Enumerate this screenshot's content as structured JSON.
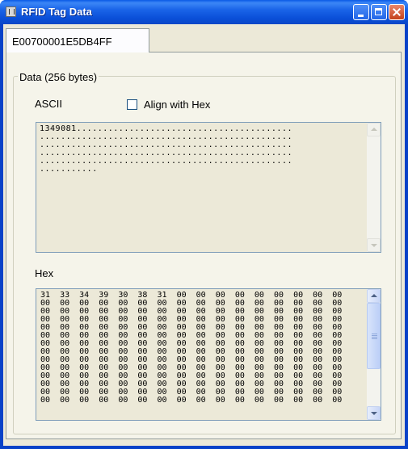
{
  "window": {
    "title": "RFID Tag Data"
  },
  "tabs": [
    {
      "label": "E00700001E5DB4FF",
      "selected": true
    }
  ],
  "data_group": {
    "label": "Data (256 bytes)"
  },
  "ascii": {
    "label": "ASCII",
    "align_with_hex_label": "Align with Hex",
    "align_with_hex_checked": false,
    "text": "1349081.........................................\n................................................\n................................................\n................................................\n................................................\n..........."
  },
  "hex": {
    "label": "Hex",
    "text": "31  33  34  39  30  38  31  00  00  00  00  00  00  00  00  00\n00  00  00  00  00  00  00  00  00  00  00  00  00  00  00  00\n00  00  00  00  00  00  00  00  00  00  00  00  00  00  00  00\n00  00  00  00  00  00  00  00  00  00  00  00  00  00  00  00\n00  00  00  00  00  00  00  00  00  00  00  00  00  00  00  00\n00  00  00  00  00  00  00  00  00  00  00  00  00  00  00  00\n00  00  00  00  00  00  00  00  00  00  00  00  00  00  00  00\n00  00  00  00  00  00  00  00  00  00  00  00  00  00  00  00\n00  00  00  00  00  00  00  00  00  00  00  00  00  00  00  00\n00  00  00  00  00  00  00  00  00  00  00  00  00  00  00  00\n00  00  00  00  00  00  00  00  00  00  00  00  00  00  00  00\n00  00  00  00  00  00  00  00  00  00  00  00  00  00  00  00\n00  00  00  00  00  00  00  00  00  00  00  00  00  00  00  00\n00  00  00  00  00  00  00  00  00  00  00  00  00  00  00  00"
  },
  "colors": {
    "titlebar": "#0a4fd8",
    "face": "#ece9d8",
    "close_button": "#c4421b"
  },
  "icons": {
    "app": "app-icon",
    "minimize": "minimize-icon",
    "maximize": "maximize-icon",
    "close": "close-icon",
    "scroll_up": "chevron-up-icon",
    "scroll_down": "chevron-down-icon"
  }
}
